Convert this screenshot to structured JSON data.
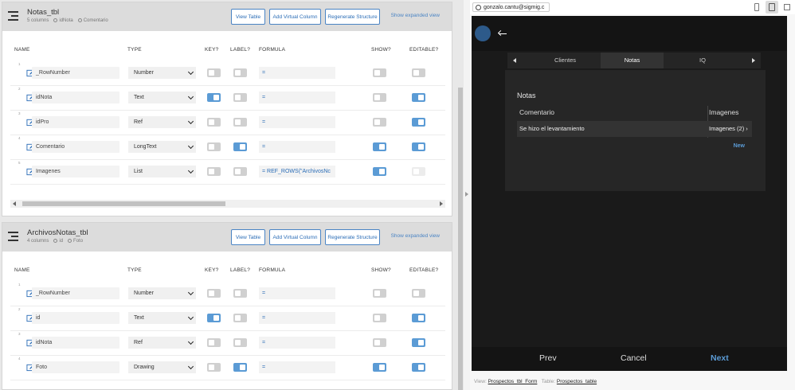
{
  "column_headers": {
    "name": "NAME",
    "type": "TYPE",
    "key": "KEY?",
    "label": "LABEL?",
    "formula": "FORMULA",
    "show": "SHOW?",
    "editable": "EDITABLE?"
  },
  "buttons": {
    "view_table": "View Table",
    "add_virtual": "Add Virtual Column",
    "regenerate": "Regenerate Structure",
    "show_expanded": "Show expanded view"
  },
  "tables": [
    {
      "title": "Notas_tbl",
      "columns_count": "5 columns",
      "key_col": "idNota",
      "label_col": "Comentario",
      "rows": [
        {
          "num": "1",
          "name": "_RowNumber",
          "type": "Number",
          "key": false,
          "label": false,
          "formula": "=",
          "show": false,
          "editable": false
        },
        {
          "num": "2",
          "name": "idNota",
          "type": "Text",
          "key": true,
          "label": false,
          "formula": "=",
          "show": false,
          "editable": true
        },
        {
          "num": "3",
          "name": "idPro",
          "type": "Ref",
          "key": false,
          "label": false,
          "formula": "=",
          "show": false,
          "editable": true
        },
        {
          "num": "4",
          "name": "Comentario",
          "type": "LongText",
          "key": false,
          "label": true,
          "formula": "=",
          "show": true,
          "editable": true
        },
        {
          "num": "5",
          "name": "Imagenes",
          "type": "List",
          "key": false,
          "label": false,
          "formula": "=    REF_ROWS(\"ArchivosNc",
          "show": true,
          "editable": false,
          "editable_disabled": true
        }
      ]
    },
    {
      "title": "ArchivosNotas_tbl",
      "columns_count": "4 columns",
      "key_col": "id",
      "label_col": "Foto",
      "rows": [
        {
          "num": "1",
          "name": "_RowNumber",
          "type": "Number",
          "key": false,
          "label": false,
          "formula": "=",
          "show": false,
          "editable": false
        },
        {
          "num": "2",
          "name": "id",
          "type": "Text",
          "key": true,
          "label": false,
          "formula": "=",
          "show": false,
          "editable": true
        },
        {
          "num": "3",
          "name": "idNota",
          "type": "Ref",
          "key": false,
          "label": false,
          "formula": "=",
          "show": false,
          "editable": true
        },
        {
          "num": "4",
          "name": "Foto",
          "type": "Drawing",
          "key": false,
          "label": true,
          "formula": "=",
          "show": true,
          "editable": true
        }
      ]
    }
  ],
  "preview": {
    "email": "gonzalo.cantu@sigmig.c",
    "tabs": [
      "Clientes",
      "Notas",
      "IQ"
    ],
    "active_tab": "Notas",
    "panel_title": "Notas",
    "col1": "Comentario",
    "col2": "Imagenes",
    "row_comment": "Se hizo el levantamiento",
    "row_images": "Imagenes (2) ›",
    "new_link": "New",
    "prev": "Prev",
    "cancel": "Cancel",
    "next": "Next",
    "view_label": "View:",
    "view_name": "Prospectos_tbl_Form",
    "table_label": "Table:",
    "table_name": "Prospectos_table"
  },
  "colors": {
    "accent": "#5b9bd5",
    "link": "#2a6cb6",
    "dark": "#1a1a1a"
  }
}
